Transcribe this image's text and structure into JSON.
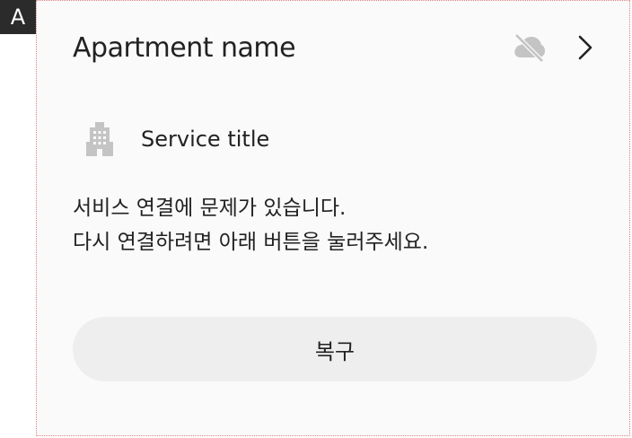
{
  "corner_label": "A",
  "card": {
    "title": "Apartment name",
    "service_title": "Service title",
    "message_line1": "서비스 연결에 문제가 있습니다.",
    "message_line2": "다시 연결하려면 아래 버튼을 눌러주세요.",
    "button_label": "복구"
  },
  "icons": {
    "cloud_off": "cloud-off-icon",
    "chevron": "chevron-right-icon",
    "building": "building-icon"
  },
  "colors": {
    "background": "#fafafa",
    "text": "#222222",
    "icon_gray": "#c4c4c4",
    "button_bg": "#eeeeee"
  }
}
